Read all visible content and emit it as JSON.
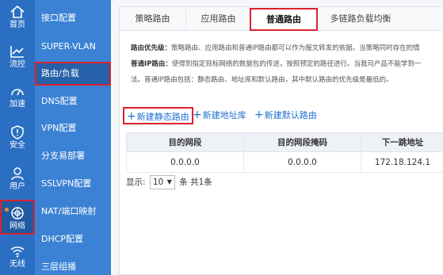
{
  "rail": {
    "items": [
      {
        "label": "首页",
        "icon": "home-icon"
      },
      {
        "label": "流控",
        "icon": "chart-icon"
      },
      {
        "label": "加速",
        "icon": "speedometer-icon"
      },
      {
        "label": "安全",
        "icon": "shield-icon"
      },
      {
        "label": "用户",
        "icon": "user-icon"
      },
      {
        "label": "网络",
        "icon": "globe-icon"
      },
      {
        "label": "无线",
        "icon": "wifi-icon"
      }
    ]
  },
  "submenu": {
    "items": [
      {
        "label": "接口配置"
      },
      {
        "label": "SUPER-VLAN"
      },
      {
        "label": "路由/负载"
      },
      {
        "label": "DNS配置"
      },
      {
        "label": "VPN配置"
      },
      {
        "label": "分支易部署"
      },
      {
        "label": "SSLVPN配置"
      },
      {
        "label": "NAT/端口映射"
      },
      {
        "label": "DHCP配置"
      },
      {
        "label": "三层组播"
      }
    ]
  },
  "tabs": [
    {
      "label": "策略路由"
    },
    {
      "label": "应用路由"
    },
    {
      "label": "普通路由"
    },
    {
      "label": "多链路负载均衡"
    }
  ],
  "description": {
    "line1_bold": "路由优先级：",
    "line1_text": "策略路由、应用路由和普通IP路由都可以作为报文转发的依据。当策略同时存在的情",
    "line2_bold": "普通IP路由：",
    "line2_text": "使得到指定目标网络的数据包的传送，按照预定的路径进行。当我司产品不能学到一",
    "line3_text": "法。普通IP路由包括：静态路由、地址库和默认路由，其中默认路由的优先级是最低的。"
  },
  "actions": {
    "plus": "+",
    "new_static_route": "新建静态路由",
    "new_address_lib": "新建地址库",
    "new_default_route": "新建默认路由"
  },
  "table": {
    "headers": [
      "目的网段",
      "目的网段掩码",
      "下一跳地址"
    ],
    "rows": [
      [
        "0.0.0.0",
        "0.0.0.0",
        "172.18.124.1"
      ]
    ]
  },
  "pager": {
    "show_label": "显示:",
    "page_size": "10",
    "caret": "▼",
    "per_page_label": "条 共1条"
  }
}
